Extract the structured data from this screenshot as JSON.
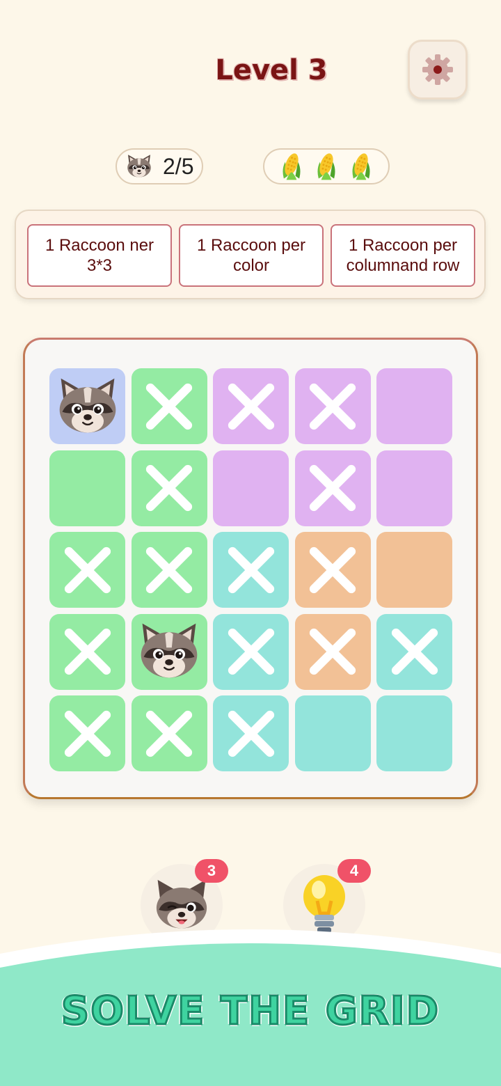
{
  "header": {
    "title": "Level 3"
  },
  "progress": {
    "count_label": "2/5",
    "icon": "raccoon-face-icon"
  },
  "lives": {
    "icon": "corn-icon",
    "count": 3
  },
  "rules": [
    {
      "text": "1 Raccoon ner 3*3"
    },
    {
      "text": "1 Raccoon per color"
    },
    {
      "text": "1 Raccoon per columnand row"
    }
  ],
  "colors": {
    "blue": "#bfcdf5",
    "green": "#94eba3",
    "purple": "#e0b2f1",
    "teal": "#93e4db",
    "orange": "#f2c196",
    "accent": "#7a1414",
    "footer": "#8fe8c8"
  },
  "grid": {
    "rows": [
      [
        {
          "color": "blue",
          "state": "raccoon"
        },
        {
          "color": "green",
          "state": "x"
        },
        {
          "color": "purple",
          "state": "x"
        },
        {
          "color": "purple",
          "state": "x"
        },
        {
          "color": "purple",
          "state": "empty"
        }
      ],
      [
        {
          "color": "green",
          "state": "empty"
        },
        {
          "color": "green",
          "state": "x"
        },
        {
          "color": "purple",
          "state": "empty"
        },
        {
          "color": "purple",
          "state": "x"
        },
        {
          "color": "purple",
          "state": "empty"
        }
      ],
      [
        {
          "color": "green",
          "state": "x"
        },
        {
          "color": "green",
          "state": "x"
        },
        {
          "color": "teal",
          "state": "x"
        },
        {
          "color": "orange",
          "state": "x"
        },
        {
          "color": "orange",
          "state": "empty"
        }
      ],
      [
        {
          "color": "green",
          "state": "x"
        },
        {
          "color": "green",
          "state": "raccoon"
        },
        {
          "color": "teal",
          "state": "x"
        },
        {
          "color": "orange",
          "state": "x"
        },
        {
          "color": "teal",
          "state": "x"
        }
      ],
      [
        {
          "color": "green",
          "state": "x"
        },
        {
          "color": "green",
          "state": "x"
        },
        {
          "color": "teal",
          "state": "x"
        },
        {
          "color": "teal",
          "state": "empty"
        },
        {
          "color": "teal",
          "state": "empty"
        }
      ]
    ]
  },
  "powerups": [
    {
      "icon": "winking-raccoon-icon",
      "badge": "3"
    },
    {
      "icon": "lightbulb-icon",
      "badge": "4"
    }
  ],
  "footer": {
    "text": "SOLVE THE GRID"
  }
}
